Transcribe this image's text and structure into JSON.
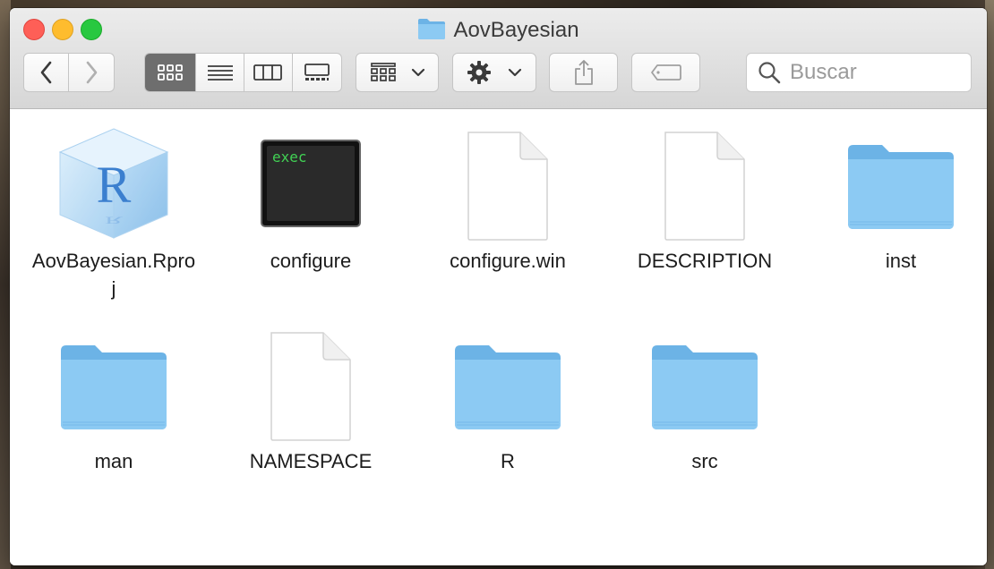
{
  "window": {
    "title": "AovBayesian"
  },
  "toolbar": {
    "back_icon": "chevron-left-icon",
    "forward_icon": "chevron-right-icon",
    "view_modes": [
      "icon-view-icon",
      "list-view-icon",
      "column-view-icon",
      "gallery-view-icon"
    ],
    "group_icon": "group-by-icon",
    "action_icon": "gear-icon",
    "share_icon": "share-icon",
    "tag_icon": "tag-icon"
  },
  "search": {
    "placeholder": "Buscar"
  },
  "files": [
    {
      "name": "AovBayesian.Rproj",
      "line1": "AovBayesian.Rpro",
      "line2": "j",
      "kind": "rproj"
    },
    {
      "name": "configure",
      "line1": "configure",
      "line2": "",
      "kind": "exec",
      "exec_text": "exec"
    },
    {
      "name": "configure.win",
      "line1": "configure.win",
      "line2": "",
      "kind": "document"
    },
    {
      "name": "DESCRIPTION",
      "line1": "DESCRIPTION",
      "line2": "",
      "kind": "document"
    },
    {
      "name": "inst",
      "line1": "inst",
      "line2": "",
      "kind": "folder"
    },
    {
      "name": "man",
      "line1": "man",
      "line2": "",
      "kind": "folder"
    },
    {
      "name": "NAMESPACE",
      "line1": "NAMESPACE",
      "line2": "",
      "kind": "document"
    },
    {
      "name": "R",
      "line1": "R",
      "line2": "",
      "kind": "folder"
    },
    {
      "name": "src",
      "line1": "src",
      "line2": "",
      "kind": "folder"
    }
  ],
  "colors": {
    "folder": "#8ccaf3",
    "folder_dark": "#6cb3e6",
    "accent_close": "#fe5f57",
    "accent_min": "#febc2e",
    "accent_max": "#28c840"
  }
}
